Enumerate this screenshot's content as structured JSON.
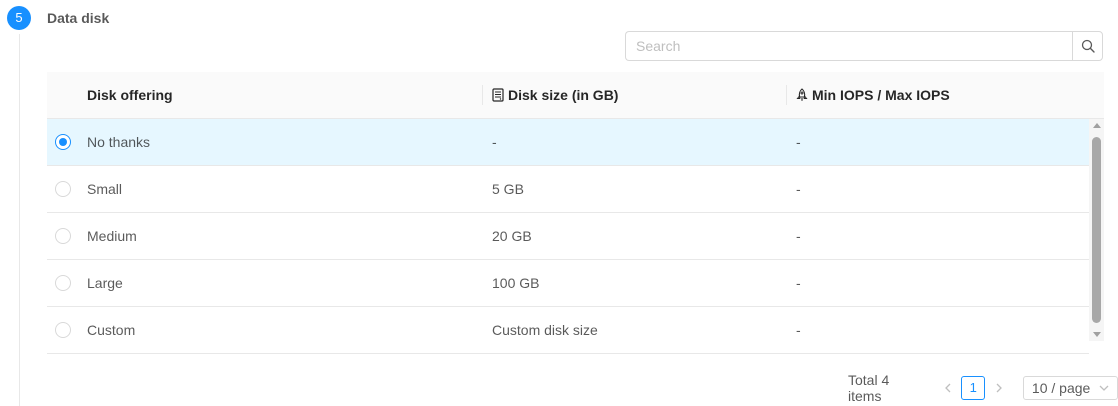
{
  "step": {
    "number": "5",
    "title": "Data disk"
  },
  "search": {
    "placeholder": "Search",
    "value": ""
  },
  "table": {
    "columns": [
      {
        "label": "Disk offering",
        "icon": "none"
      },
      {
        "label": "Disk size (in GB)",
        "icon": "hdd-icon"
      },
      {
        "label": "Min IOPS / Max IOPS",
        "icon": "rocket-icon"
      }
    ],
    "rows": [
      {
        "offering": "No thanks",
        "size": "-",
        "iops": "-",
        "selected": true
      },
      {
        "offering": "Small",
        "size": "5 GB",
        "iops": "-",
        "selected": false
      },
      {
        "offering": "Medium",
        "size": "20 GB",
        "iops": "-",
        "selected": false
      },
      {
        "offering": "Large",
        "size": "100 GB",
        "iops": "-",
        "selected": false
      },
      {
        "offering": "Custom",
        "size": "Custom disk size",
        "iops": "-",
        "selected": false
      }
    ]
  },
  "pagination": {
    "total_text": "Total 4 items",
    "current_page": "1",
    "page_size": "10 / page"
  },
  "colors": {
    "primary": "#1890ff",
    "selected_row": "#e6f7ff",
    "header_bg": "#fafafa",
    "border": "#e8e8e8"
  }
}
